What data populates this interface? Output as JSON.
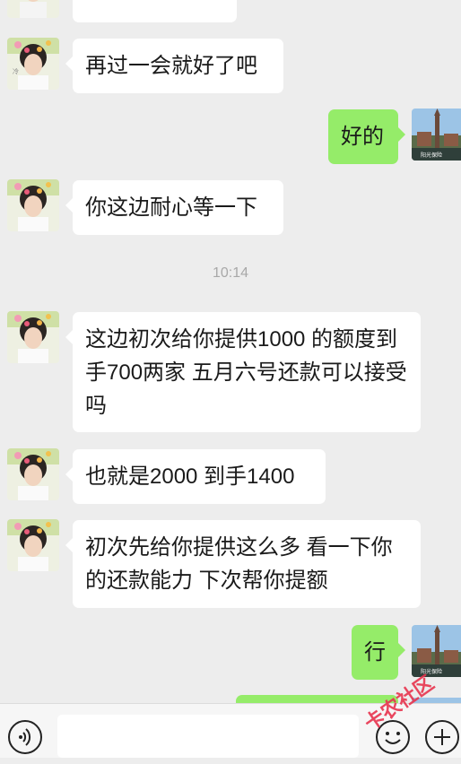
{
  "messages": [
    {
      "from": "peer",
      "text": "再过一会就好了吧"
    },
    {
      "from": "me",
      "text": "好的"
    },
    {
      "from": "peer",
      "text": "你这边耐心等一下"
    },
    {
      "from": "peer",
      "text": "这边初次给你提供1000 的额度到手700两家 五月六号还款可以接受吗"
    },
    {
      "from": "peer",
      "text": "也就是2000 到手1400"
    },
    {
      "from": "peer",
      "text": "初次先给你提供这么多 看一下你的还款能力 下次帮你提额"
    },
    {
      "from": "me",
      "text": "行"
    }
  ],
  "timestamp": "10:14",
  "watermark_text": "卡农社区",
  "colors": {
    "background": "#ededed",
    "peer_bubble": "#ffffff",
    "my_bubble": "#95ec69",
    "timestamp": "#a8a8a8"
  },
  "icons": {
    "voice": "voice-icon",
    "emoji": "emoji-icon",
    "more": "plus-icon"
  }
}
